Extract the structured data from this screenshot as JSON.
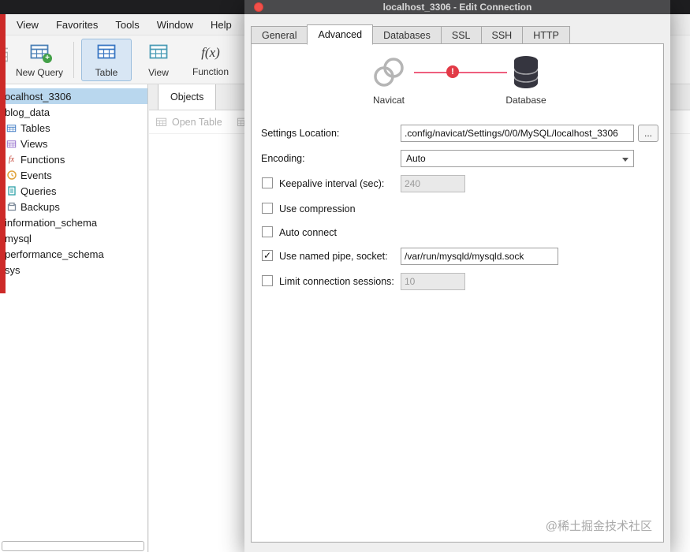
{
  "window": {
    "menu": [
      "View",
      "Favorites",
      "Tools",
      "Window",
      "Help"
    ],
    "toolbar": [
      {
        "label": "New Query",
        "icon": "new-query"
      },
      {
        "separator": true
      },
      {
        "label": "Table",
        "icon": "table",
        "selected": true
      },
      {
        "label": "View",
        "icon": "view"
      },
      {
        "label": "Function",
        "icon": "function"
      }
    ],
    "sidebar": [
      {
        "label": "localhost_3306",
        "kind": "connection",
        "icon": "connection",
        "selected": true
      },
      {
        "label": "blog_data",
        "kind": "database",
        "icon": "database"
      },
      {
        "label": "Tables",
        "kind": "object",
        "icon": "tables"
      },
      {
        "label": "Views",
        "kind": "object",
        "icon": "views"
      },
      {
        "label": "Functions",
        "kind": "object",
        "icon": "functions"
      },
      {
        "label": "Events",
        "kind": "object",
        "icon": "events"
      },
      {
        "label": "Queries",
        "kind": "object",
        "icon": "queries"
      },
      {
        "label": "Backups",
        "kind": "object",
        "icon": "backups"
      },
      {
        "label": "information_schema",
        "kind": "database",
        "icon": "database"
      },
      {
        "label": "mysql",
        "kind": "database",
        "icon": "database"
      },
      {
        "label": "performance_schema",
        "kind": "database",
        "icon": "database"
      },
      {
        "label": "sys",
        "kind": "database",
        "icon": "database"
      }
    ],
    "objects_tab": "Objects",
    "open_table": "Open Table"
  },
  "dialog": {
    "title": "localhost_3306 - Edit Connection",
    "tabs": [
      {
        "label": "General"
      },
      {
        "label": "Advanced",
        "active": true
      },
      {
        "label": "Databases"
      },
      {
        "label": "SSL"
      },
      {
        "label": "SSH"
      },
      {
        "label": "HTTP"
      }
    ],
    "diagram": {
      "source": "Navicat",
      "target": "Database",
      "error_badge": "!"
    },
    "form": {
      "settings_location": {
        "label": "Settings Location:",
        "value": ".config/navicat/Settings/0/0/MySQL/localhost_3306",
        "browse": "..."
      },
      "encoding": {
        "label": "Encoding:",
        "value": "Auto"
      },
      "keepalive": {
        "label": "Keepalive interval (sec):",
        "value": "240",
        "checked": false
      },
      "compression": {
        "label": "Use compression",
        "checked": false
      },
      "auto_connect": {
        "label": "Auto connect",
        "checked": false
      },
      "named_pipe": {
        "label": "Use named pipe, socket:",
        "value": "/var/run/mysqld/mysqld.sock",
        "checked": true
      },
      "limit_sessions": {
        "label": "Limit connection sessions:",
        "value": "10",
        "checked": false
      }
    },
    "watermark": "@稀土掘金技术社区"
  },
  "colors": {
    "selection": "#b9d7ee",
    "red_strip": "#cd2a28",
    "error_badge": "#e23a46",
    "connection_line": "#ee5f7e",
    "titlebar": "#4a4a4c"
  }
}
